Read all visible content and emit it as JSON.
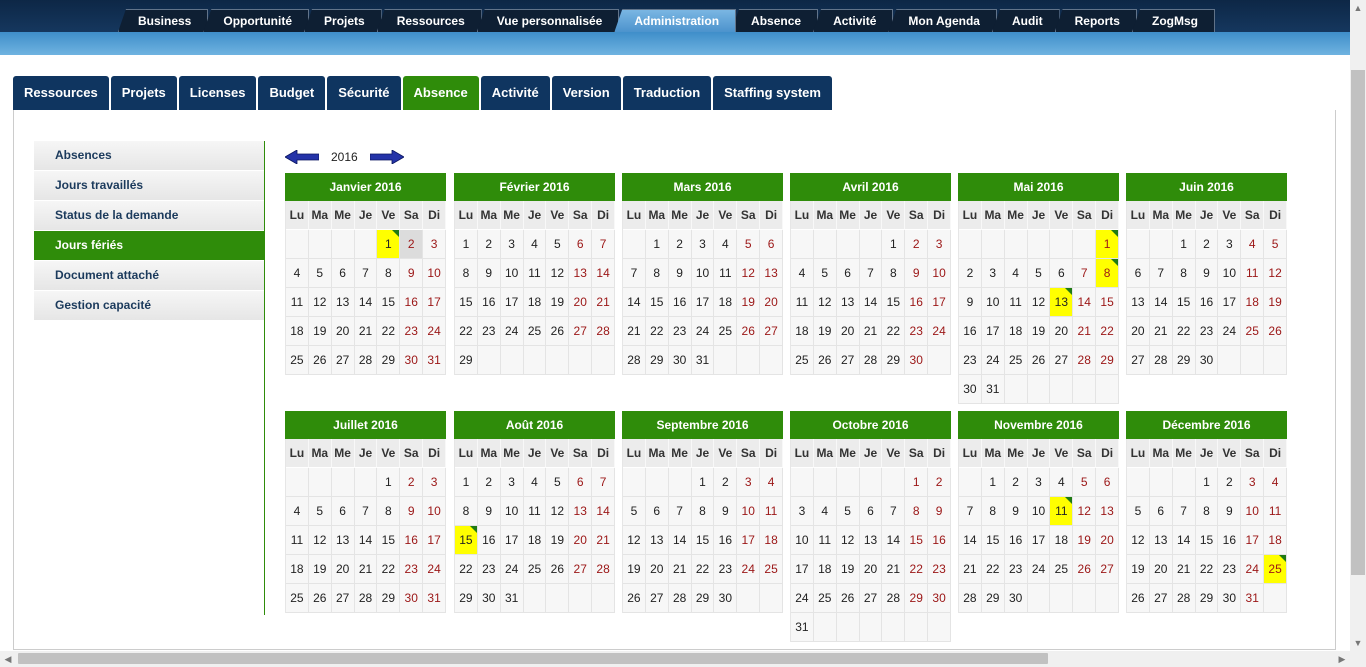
{
  "top_nav": {
    "tabs": [
      {
        "label": "Business"
      },
      {
        "label": "Opportunité"
      },
      {
        "label": "Projets"
      },
      {
        "label": "Ressources"
      },
      {
        "label": "Vue personnalisée"
      },
      {
        "label": "Administration",
        "active": true
      },
      {
        "label": "Absence"
      },
      {
        "label": "Activité"
      },
      {
        "label": "Mon Agenda"
      },
      {
        "label": "Audit"
      },
      {
        "label": "Reports"
      },
      {
        "label": "ZogMsg"
      }
    ]
  },
  "admin_tabs": [
    {
      "label": "Ressources"
    },
    {
      "label": "Projets"
    },
    {
      "label": "Licenses"
    },
    {
      "label": "Budget"
    },
    {
      "label": "Sécurité"
    },
    {
      "label": "Absence",
      "active": true
    },
    {
      "label": "Activité"
    },
    {
      "label": "Version"
    },
    {
      "label": "Traduction"
    },
    {
      "label": "Staffing system"
    }
  ],
  "side_menu": [
    {
      "label": "Absences"
    },
    {
      "label": "Jours travaillés"
    },
    {
      "label": "Status de la demande"
    },
    {
      "label": "Jours fériés",
      "active": true
    },
    {
      "label": "Document attaché"
    },
    {
      "label": "Gestion capacité"
    }
  ],
  "calendar": {
    "year": "2016",
    "prev_icon": "left-arrow-icon",
    "next_icon": "right-arrow-icon",
    "weekdays": [
      "Lu",
      "Ma",
      "Me",
      "Je",
      "Ve",
      "Sa",
      "Di"
    ],
    "colors": {
      "header": "#2f8c0a",
      "holiday": "#ffff00",
      "weekend_text": "#9b1616",
      "holiday_marker": "#1f7a14"
    },
    "months": [
      {
        "title": "Janvier 2016",
        "offset": 4,
        "days": 31,
        "weeks": 5,
        "holidays": [
          1
        ],
        "today": 2
      },
      {
        "title": "Février 2016",
        "offset": 0,
        "days": 29,
        "weeks": 5,
        "holidays": []
      },
      {
        "title": "Mars 2016",
        "offset": 1,
        "days": 31,
        "weeks": 5,
        "holidays": []
      },
      {
        "title": "Avril 2016",
        "offset": 4,
        "days": 30,
        "weeks": 5,
        "holidays": []
      },
      {
        "title": "Mai 2016",
        "offset": 6,
        "days": 31,
        "weeks": 6,
        "holidays": [
          1,
          8,
          13
        ]
      },
      {
        "title": "Juin 2016",
        "offset": 2,
        "days": 30,
        "weeks": 5,
        "holidays": []
      },
      {
        "title": "Juillet 2016",
        "offset": 4,
        "days": 31,
        "weeks": 5,
        "holidays": []
      },
      {
        "title": "Août 2016",
        "offset": 0,
        "days": 31,
        "weeks": 5,
        "holidays": [
          15
        ]
      },
      {
        "title": "Septembre 2016",
        "offset": 3,
        "days": 30,
        "weeks": 5,
        "holidays": []
      },
      {
        "title": "Octobre 2016",
        "offset": 5,
        "days": 31,
        "weeks": 6,
        "holidays": []
      },
      {
        "title": "Novembre 2016",
        "offset": 1,
        "days": 30,
        "weeks": 5,
        "holidays": [
          11
        ]
      },
      {
        "title": "Décembre 2016",
        "offset": 3,
        "days": 31,
        "weeks": 5,
        "holidays": [
          25
        ]
      }
    ]
  }
}
